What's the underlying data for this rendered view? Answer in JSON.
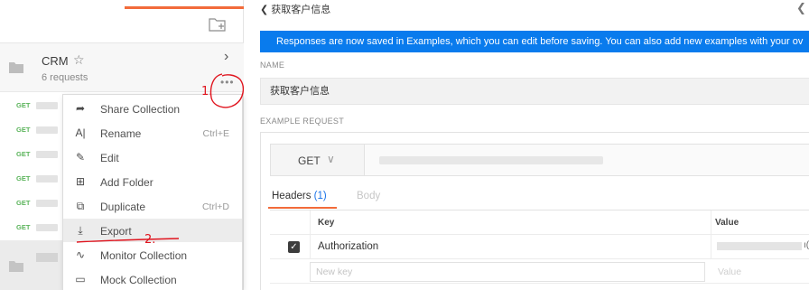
{
  "sidebar": {
    "collection": {
      "name": "CRM",
      "star_icon": "☆",
      "request_count": "6 requests",
      "more_label": "•••",
      "chevron": "›"
    },
    "requests": [
      {
        "method": "GET"
      },
      {
        "method": "GET"
      },
      {
        "method": "GET"
      },
      {
        "method": "GET"
      },
      {
        "method": "GET"
      },
      {
        "method": "GET"
      }
    ]
  },
  "context_menu": {
    "items": [
      {
        "label": "Share Collection",
        "icon": "share-icon",
        "glyph": "➦",
        "shortcut": ""
      },
      {
        "label": "Rename",
        "icon": "rename-icon",
        "glyph": "A|",
        "shortcut": "Ctrl+E"
      },
      {
        "label": "Edit",
        "icon": "pencil-icon",
        "glyph": "✎",
        "shortcut": ""
      },
      {
        "label": "Add Folder",
        "icon": "add-folder-icon",
        "glyph": "⊞",
        "shortcut": ""
      },
      {
        "label": "Duplicate",
        "icon": "duplicate-icon",
        "glyph": "⧉",
        "shortcut": "Ctrl+D"
      },
      {
        "label": "Export",
        "icon": "download-icon",
        "glyph": "⤓",
        "shortcut": ""
      },
      {
        "label": "Monitor Collection",
        "icon": "pulse-icon",
        "glyph": "∿",
        "shortcut": ""
      },
      {
        "label": "Mock Collection",
        "icon": "server-icon",
        "glyph": "▭",
        "shortcut": ""
      }
    ]
  },
  "main": {
    "back_title": "❮ 获取客户信息",
    "right_chevron": "❮",
    "banner": "Responses are now saved in Examples, which you can edit before saving. You can also add new examples with your ov",
    "name_label": "NAME",
    "name_value": "获取客户信息",
    "example_label": "EXAMPLE REQUEST",
    "method": "GET",
    "method_chevron": "∨",
    "tabs": {
      "headers": "Headers",
      "headers_count": "(1)",
      "body": "Body"
    },
    "headers_table": {
      "key_col": "Key",
      "value_col": "Value",
      "rows": [
        {
          "checked": true,
          "key": "Authorization",
          "value_tail": "ı("
        }
      ],
      "new_key_placeholder": "New key",
      "new_value_placeholder": "Value"
    }
  },
  "annotations": {
    "step1": "1.",
    "step2": "2."
  },
  "colors": {
    "accent": "#f26b3a",
    "banner": "#097bed",
    "get_method": "#5bb45b",
    "annotation": "#e0141e"
  }
}
